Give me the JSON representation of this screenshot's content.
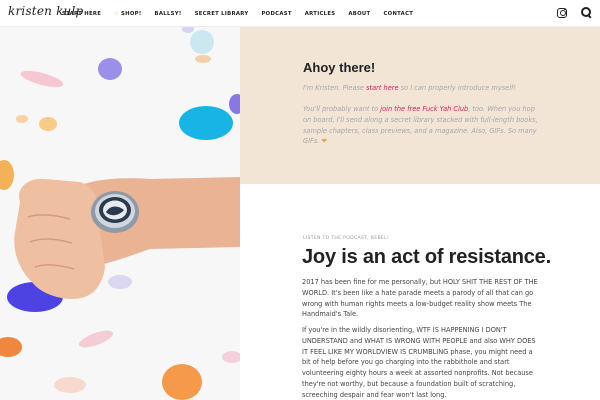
{
  "site": {
    "logo": "kristen kulp"
  },
  "nav": {
    "items": [
      {
        "label": "START HERE",
        "starred": false
      },
      {
        "label": "SHOP!",
        "starred": true
      },
      {
        "label": "BALLSY!",
        "starred": false
      },
      {
        "label": "SECRET LIBRARY",
        "starred": false
      },
      {
        "label": "PODCAST",
        "starred": false
      },
      {
        "label": "ARTICLES",
        "starred": false
      },
      {
        "label": "ABOUT",
        "starred": false
      },
      {
        "label": "CONTACT",
        "starred": false
      }
    ],
    "icons": [
      "instagram-icon",
      "search-icon"
    ]
  },
  "welcome": {
    "title": "Ahoy there!",
    "p1_before": "I'm Kristen. Please ",
    "p1_link": "start here",
    "p1_after": " so I can properly introduce myself!",
    "p2_before": "You'll probably want to ",
    "p2_link": "join the free Fuck Yah Club",
    "p2_after": ", too. When you hop on board, I'll send along a secret library stacked with full-length books, sample chapters, class previews, and a magazine. Also, GIFs. So many GIFs. ",
    "heart": "❤"
  },
  "post": {
    "kicker": "LISTEN TO THE PODCAST, REBEL!",
    "title": "Joy is an act of resistance.",
    "paragraph1": "2017 has been fine for me personally, but HOLY SHIT THE REST OF THE WORLD.  It's been like a hate parade meets a parody of all that can go wrong with human rights meets a low-budget reality show meets The Handmaid's Tale.",
    "paragraph2": "If you're in the wildly disorienting, WTF IS HAPPENING I DON'T UNDERSTAND and WHAT IS WRONG WITH PEOPLE and also WHY DOES IT FEEL LIKE MY WORLDVIEW IS CRUMBLING phase, you might need a bit of help before you go charging into the rabbithole and start volunteering eighty hours a week at assorted nonprofits.  Not because they're not worthy, but because a foundation built of scratching, screeching despair and fear won't last long."
  },
  "colors": {
    "welcome_bg": "#f3e5d6",
    "link_pink": "#c8245c",
    "accent_orange": "#e8a64a"
  }
}
